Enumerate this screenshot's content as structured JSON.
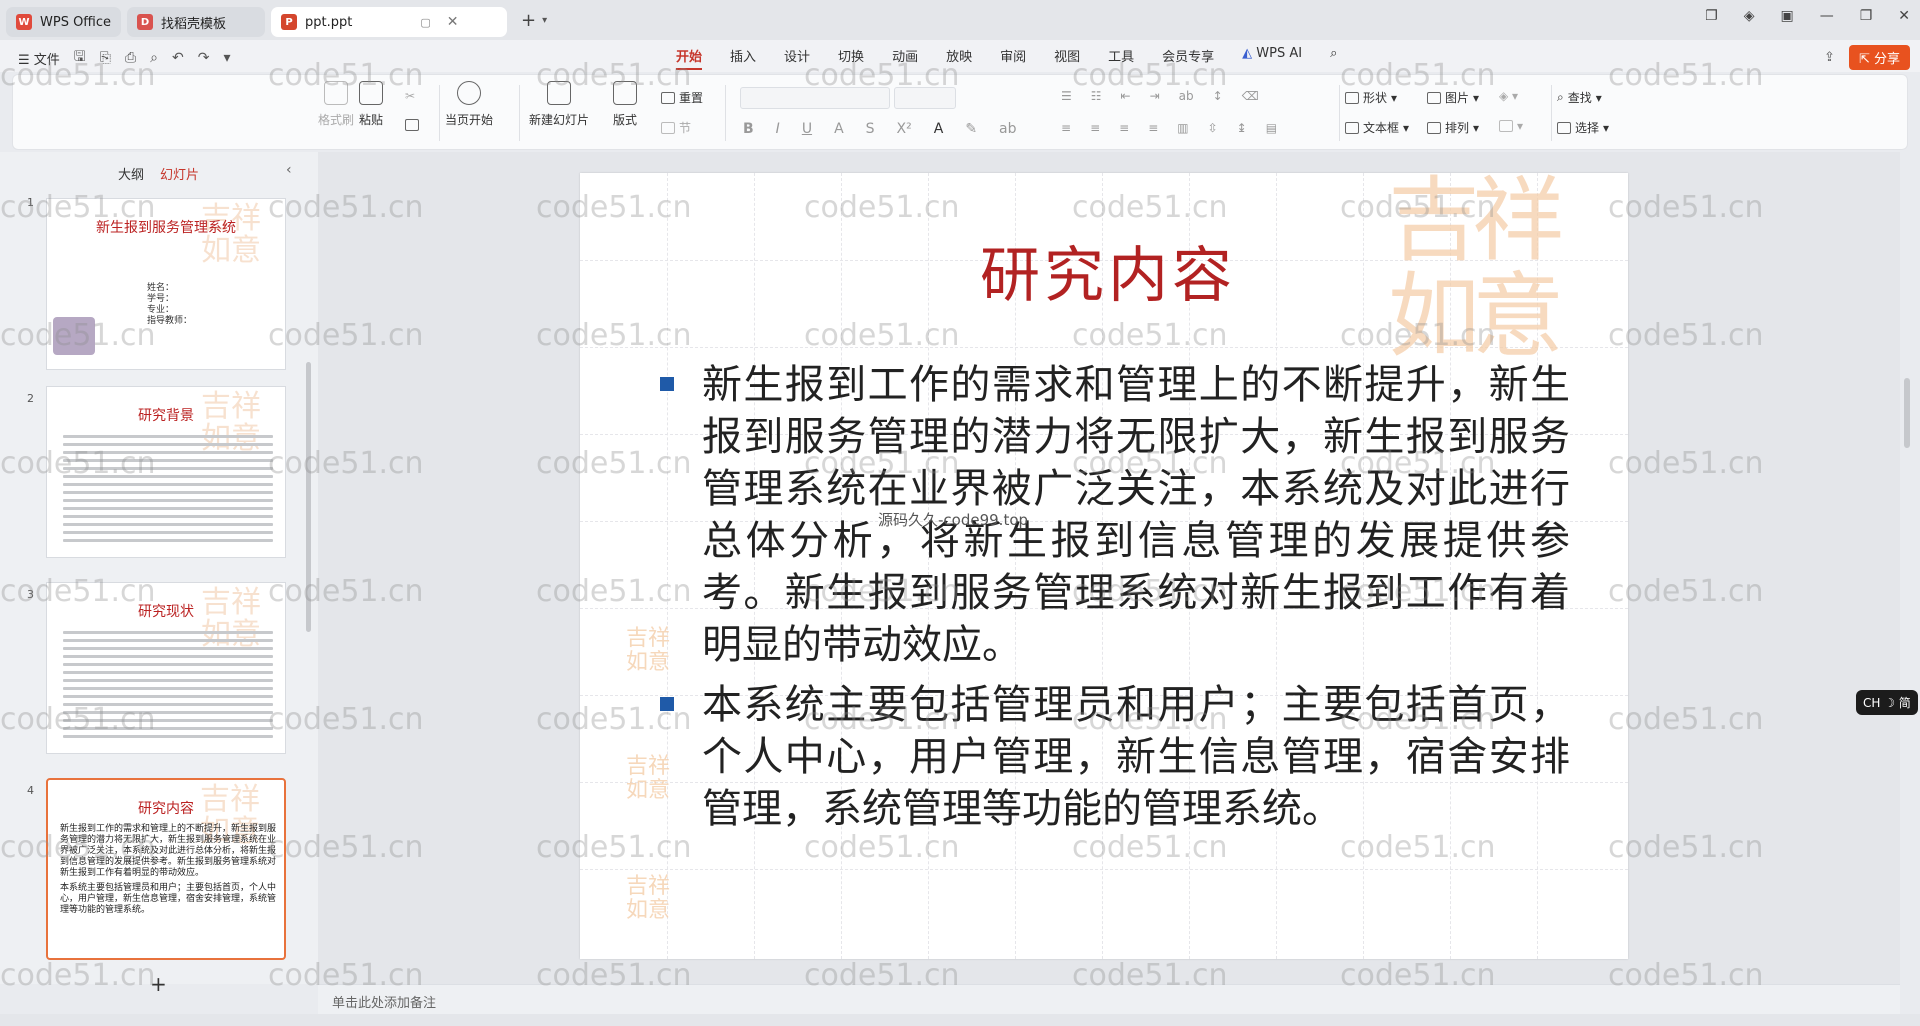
{
  "tabs": [
    {
      "label": "WPS Office",
      "logo": "W",
      "logo_color": "#e04a3c"
    },
    {
      "label": "找稻壳模板",
      "logo": "D",
      "logo_color": "#d9534f"
    },
    {
      "label": "ppt.ppt",
      "logo": "P",
      "logo_color": "#d4462d"
    }
  ],
  "menu_left": {
    "file": "☰ 文件"
  },
  "menu_tabs": [
    "开始",
    "插入",
    "设计",
    "切换",
    "动画",
    "放映",
    "审阅",
    "视图",
    "工具",
    "会员专享"
  ],
  "wps_ai": "WPS AI",
  "share": "分享",
  "ribbon": {
    "format_painter": "格式刷",
    "paste": "粘贴",
    "from_current": "当页开始",
    "new_slide": "新建幻灯片",
    "layout": "版式",
    "reset": "重置",
    "section": "节",
    "shape": "形状",
    "picture": "图片",
    "find": "查找",
    "textbox": "文本框",
    "arrange": "排列",
    "select": "选择"
  },
  "left_panel": {
    "tab_outline": "大纲",
    "tab_slides": "幻灯片",
    "add": "+"
  },
  "thumbnails": [
    {
      "num": "1",
      "title": "新生报到服务管理系统",
      "fields": [
        "姓名：",
        "学号：",
        "专业：",
        "指导教师："
      ]
    },
    {
      "num": "2",
      "title": "研究背景"
    },
    {
      "num": "3",
      "title": "研究现状"
    },
    {
      "num": "4",
      "title": "研究内容",
      "text": "新生报到工作的需求和管理上的不断提升，新生报到服务管理的潜力将无限扩大，新生报到服务管理系统在业界被广泛关注，本系统及对此进行总体分析，将新生报到信息管理的发展提供参考。新生报到服务管理系统对新生报到工作有着明显的带动效应。",
      "text2": "本系统主要包括管理员和用户；主要包括首页，个人中心，用户管理，新生信息管理，宿舍安排管理，系统管理等功能的管理系统。"
    }
  ],
  "slide": {
    "title": "研究内容",
    "bullets": [
      "新生报到工作的需求和管理上的不断提升，新生报到服务管理的潜力将无限扩大，新生报到服务管理系统在业界被广泛关注，本系统及对此进行总体分析，将新生报到信息管理的发展提供参考。新生报到服务管理系统对新生报到工作有着明显的带动效应。",
      "本系统主要包括管理员和用户；主要包括首页，个人中心，用户管理，新生信息管理，宿舍安排管理，系统管理等功能的管理系统。"
    ],
    "watermark": "源码久久-code99.top",
    "seal_text": "吉祥如意"
  },
  "notes_placeholder": "单击此处添加备注",
  "ime_badge": "CH ☽ 简",
  "watermark_text": "code51.cn",
  "colors": {
    "accent": "#c6362b",
    "title_red": "#b22222",
    "bullet_blue": "#1f5aa8",
    "share_orange": "#e8521f"
  }
}
